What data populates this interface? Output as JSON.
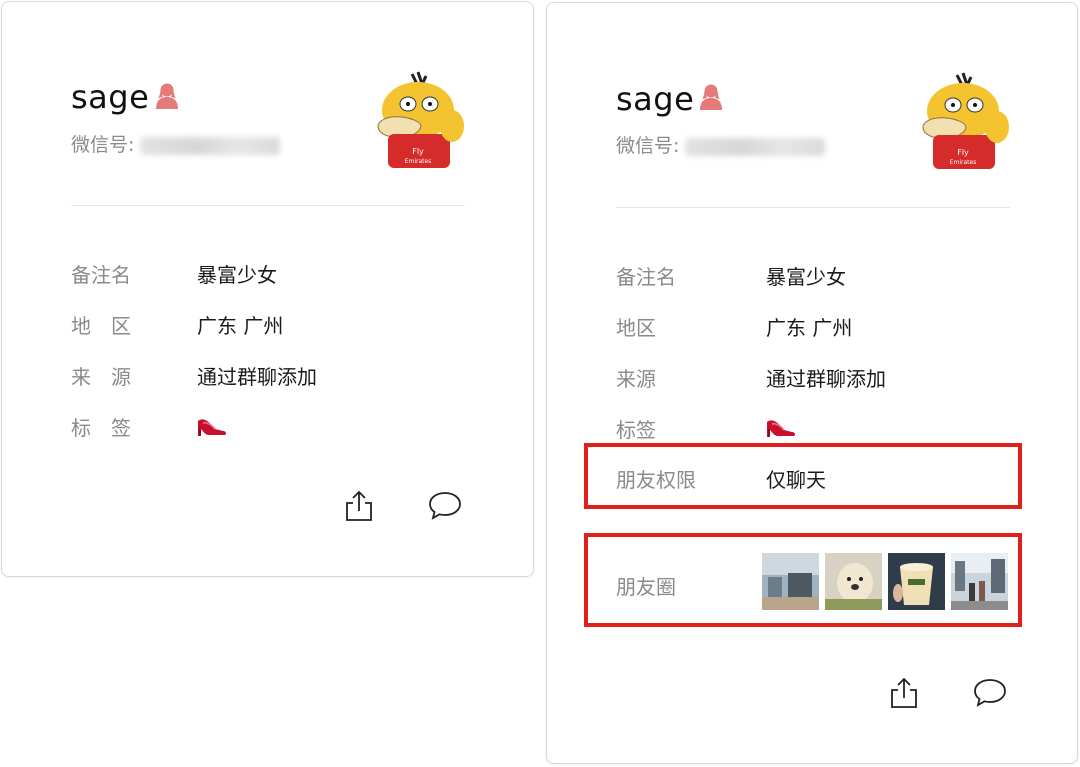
{
  "left_card": {
    "name": "sage",
    "wechat_id_label": "微信号:",
    "rows": [
      {
        "label": "备注名",
        "value": "暴富少女"
      },
      {
        "label": "地　区",
        "value": "广东 广州"
      },
      {
        "label": "来　源",
        "value": "通过群聊添加"
      },
      {
        "label": "标　签",
        "value": ""
      }
    ]
  },
  "right_card": {
    "name": "sage",
    "wechat_id_label": "微信号:",
    "rows": [
      {
        "label": "备注名",
        "value": "暴富少女"
      },
      {
        "label": "地区",
        "value": "广东 广州"
      },
      {
        "label": "来源",
        "value": "通过群聊添加"
      },
      {
        "label": "标签",
        "value": ""
      },
      {
        "label": "朋友权限",
        "value": "仅聊天"
      },
      {
        "label": "朋友圈",
        "value": ""
      }
    ]
  },
  "icons": {
    "gender": "female-user-icon",
    "tag": "high-heel-icon",
    "share": "share-icon",
    "message": "chat-bubble-icon"
  },
  "colors": {
    "highlight": "#e0201b",
    "gender_icon": "#e57a7a",
    "label_gray": "#8a8a8a"
  }
}
